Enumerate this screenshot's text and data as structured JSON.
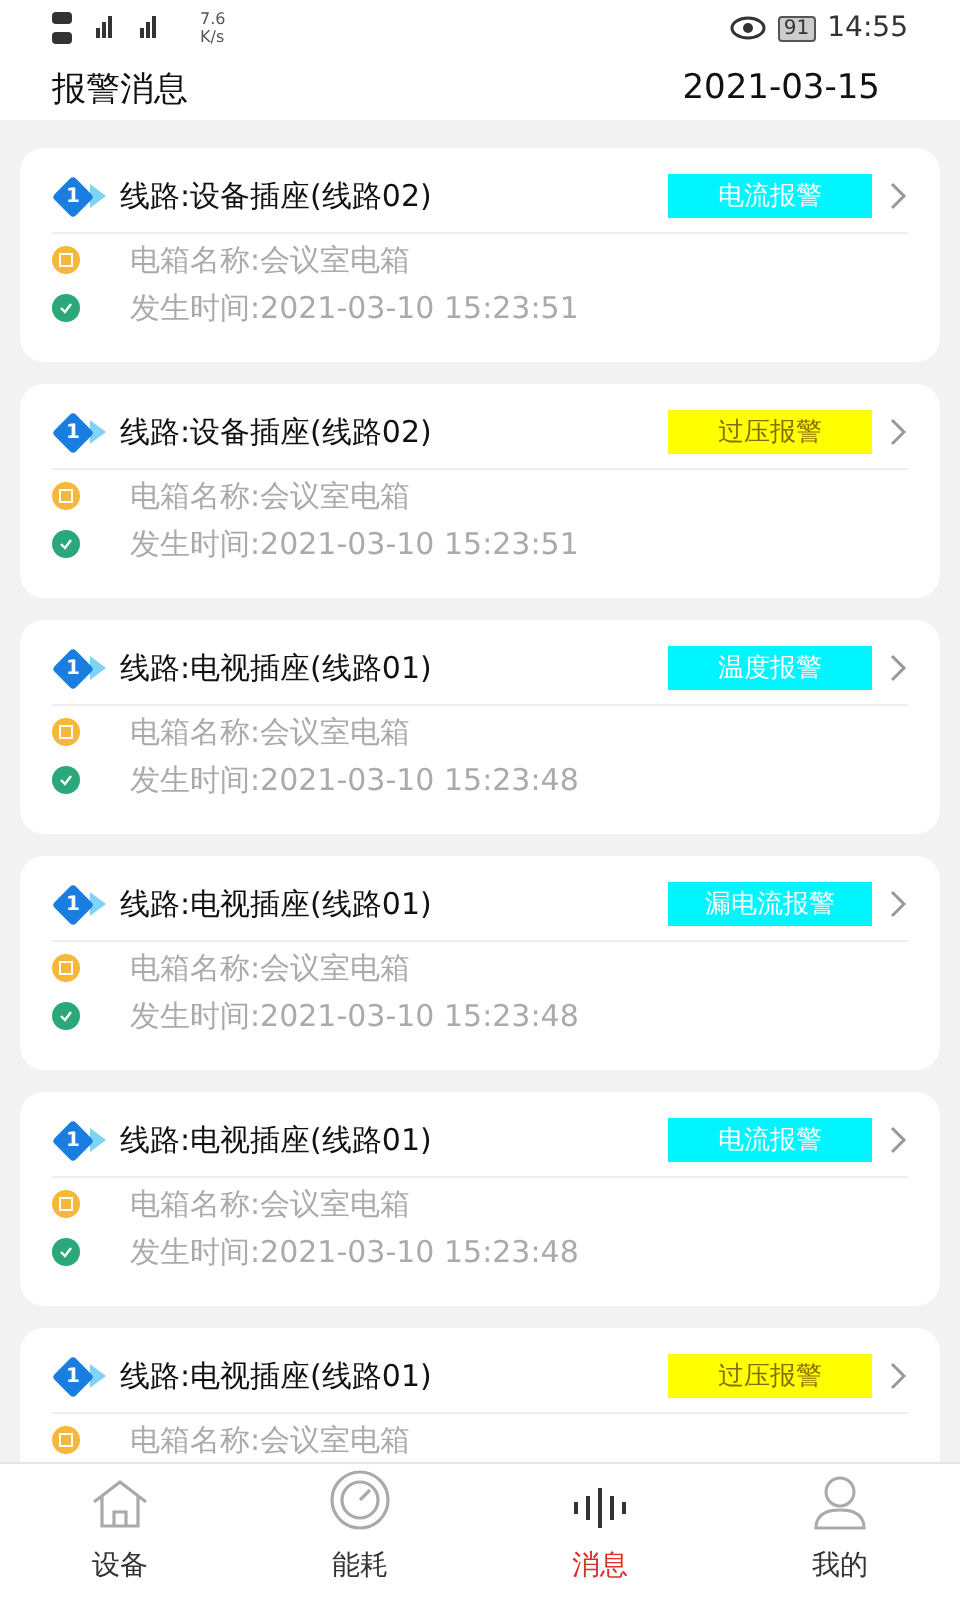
{
  "status_bar": {
    "speed_value": "7.6",
    "speed_unit": "K/s",
    "battery": "91",
    "time": "14:55"
  },
  "header": {
    "title": "报警消息",
    "date": "2021-03-15"
  },
  "alarms": [
    {
      "index": "1",
      "line": "线路:设备插座(线路02)",
      "type": "电流报警",
      "color": "#00f5ff",
      "box_name": "电箱名称:会议室电箱",
      "time": "发生时间:2021-03-10 15:23:51"
    },
    {
      "index": "1",
      "line": "线路:设备插座(线路02)",
      "type": "过压报警",
      "color": "#ffff00",
      "box_name": "电箱名称:会议室电箱",
      "time": "发生时间:2021-03-10 15:23:51"
    },
    {
      "index": "1",
      "line": "线路:电视插座(线路01)",
      "type": "温度报警",
      "color": "#00f5ff",
      "box_name": "电箱名称:会议室电箱",
      "time": "发生时间:2021-03-10 15:23:48"
    },
    {
      "index": "1",
      "line": "线路:电视插座(线路01)",
      "type": "漏电流报警",
      "color": "#00f5ff",
      "box_name": "电箱名称:会议室电箱",
      "time": "发生时间:2021-03-10 15:23:48"
    },
    {
      "index": "1",
      "line": "线路:电视插座(线路01)",
      "type": "电流报警",
      "color": "#00f5ff",
      "box_name": "电箱名称:会议室电箱",
      "time": "发生时间:2021-03-10 15:23:48"
    },
    {
      "index": "1",
      "line": "线路:电视插座(线路01)",
      "type": "过压报警",
      "color": "#ffff00",
      "box_name": "电箱名称:会议室电箱"
    }
  ],
  "tabs": [
    {
      "label": "设备",
      "kind": "home",
      "selected": false
    },
    {
      "label": "能耗",
      "kind": "gauge",
      "selected": false
    },
    {
      "label": "消息",
      "kind": "wave",
      "selected": true
    },
    {
      "label": "我的",
      "kind": "user",
      "selected": false
    }
  ]
}
